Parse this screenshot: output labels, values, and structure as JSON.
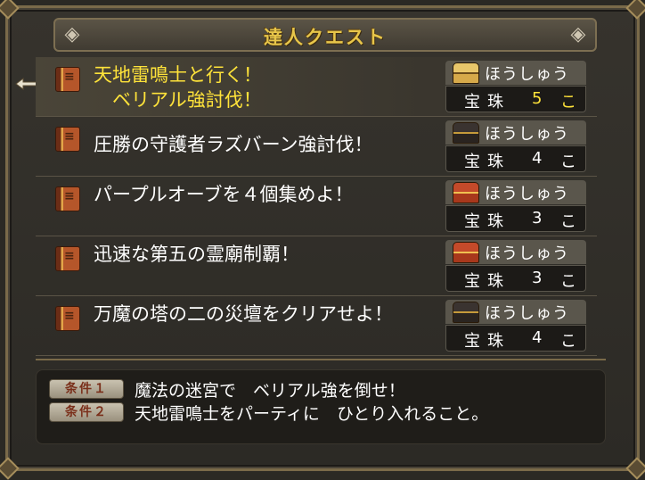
{
  "window": {
    "title": "達人クエスト"
  },
  "quests": [
    {
      "name": "天地雷鳴士と行く！\n　ベリアル強討伐！",
      "reward_label": "ほうしゅう",
      "reward_item": "宝珠",
      "reward_count": "5",
      "reward_unit": "こ",
      "chest": "gold-chest-icon",
      "selected": true
    },
    {
      "name": "圧勝の守護者ラズバーン強討伐！",
      "reward_label": "ほうしゅう",
      "reward_item": "宝珠",
      "reward_count": "4",
      "reward_unit": "こ",
      "chest": "black-chest-icon",
      "selected": false
    },
    {
      "name": "パープルオーブを４個集めよ！",
      "reward_label": "ほうしゅう",
      "reward_item": "宝珠",
      "reward_count": "3",
      "reward_unit": "こ",
      "chest": "red-chest-icon",
      "selected": false
    },
    {
      "name": "迅速な第五の霊廟制覇！",
      "reward_label": "ほうしゅう",
      "reward_item": "宝珠",
      "reward_count": "3",
      "reward_unit": "こ",
      "chest": "red-chest-icon",
      "selected": false
    },
    {
      "name": "万魔の塔の二の災壇をクリアせよ！",
      "reward_label": "ほうしゅう",
      "reward_item": "宝珠",
      "reward_count": "4",
      "reward_unit": "こ",
      "chest": "black-chest-icon",
      "selected": false
    }
  ],
  "conditions": [
    {
      "badge": "条件１",
      "text": "魔法の迷宮で　ベリアル強を倒せ！"
    },
    {
      "badge": "条件２",
      "text": "天地雷鳴士をパーティに　ひとり入れること。"
    }
  ],
  "colors": {
    "title": "#e8c64a",
    "selected_text": "#ffe33a",
    "text": "#ffffff",
    "frame": "#7a6a49"
  }
}
